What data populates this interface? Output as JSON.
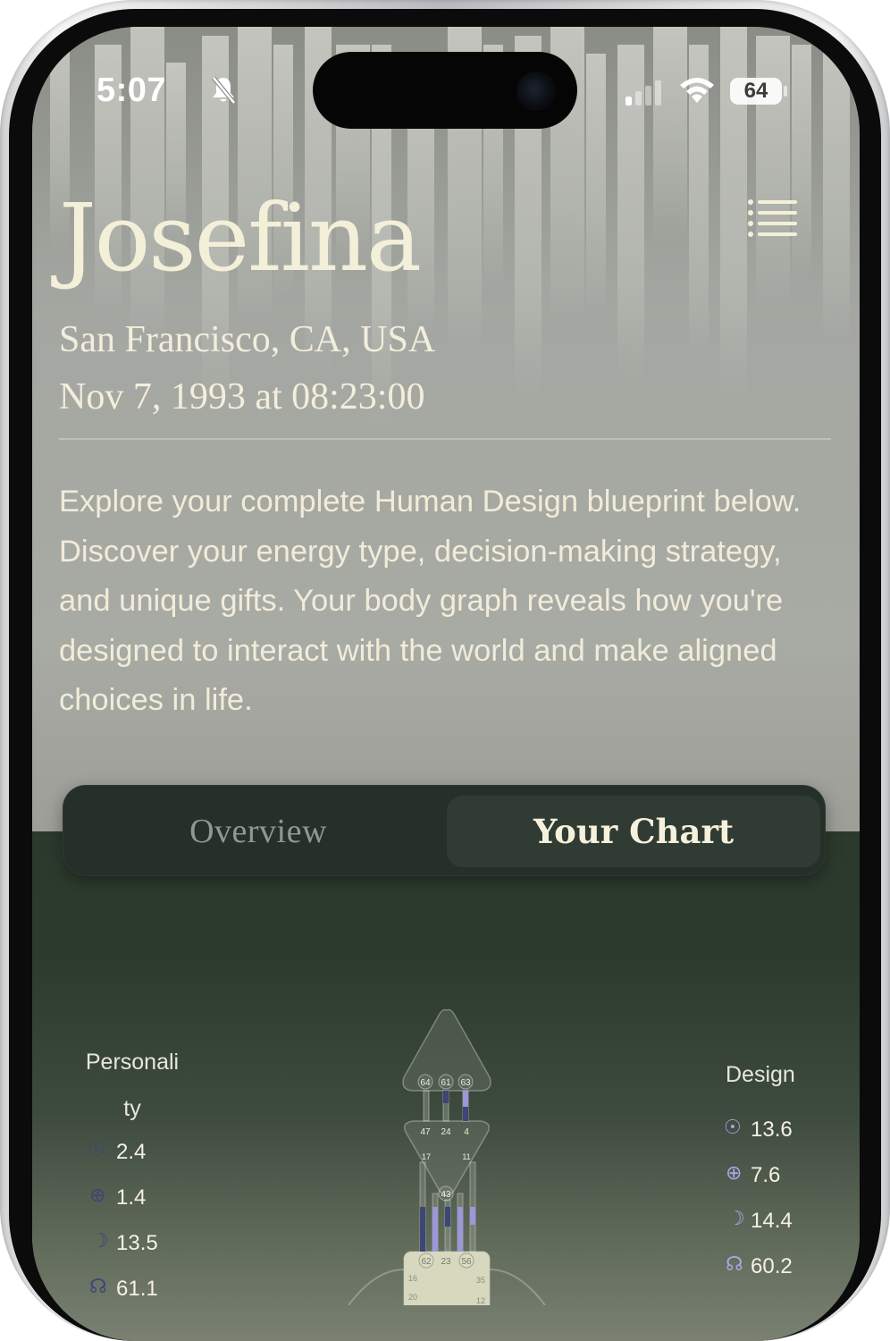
{
  "status_bar": {
    "time": "5:07",
    "battery": "64",
    "icons": [
      "bell-slash-icon",
      "signal-icon",
      "wifi-icon",
      "battery-icon"
    ]
  },
  "header": {
    "name": "Josefina",
    "location": "San Francisco, CA, USA",
    "birth": "Nov 7, 1993 at 08:23:00",
    "menu_icon": "hamburger-menu-icon"
  },
  "intro": "Explore your complete Human Design blueprint below. Discover your energy type, decision-making strategy, and unique gifts. Your body graph reveals how you're designed to interact with the world and make aligned choices in life.",
  "tabs": [
    {
      "label": "Overview",
      "active": false
    },
    {
      "label": "Your Chart",
      "active": true
    }
  ],
  "chart": {
    "personality": {
      "title_line1": "Personali",
      "title_line2": "ty",
      "rows": [
        {
          "icon": "sun-icon",
          "value": "2.4"
        },
        {
          "icon": "earth-icon",
          "value": "1.4"
        },
        {
          "icon": "moon-icon",
          "value": "13.5"
        },
        {
          "icon": "north-node-icon",
          "value": "61.1"
        }
      ]
    },
    "design": {
      "title": "Design",
      "rows": [
        {
          "icon": "sun-icon",
          "value": "13.6"
        },
        {
          "icon": "earth-icon",
          "value": "7.6"
        },
        {
          "icon": "moon-icon",
          "value": "14.4"
        },
        {
          "icon": "north-node-icon",
          "value": "60.2"
        }
      ]
    },
    "gates": {
      "head": [
        "64",
        "61",
        "63"
      ],
      "ajna_top": [
        "47",
        "24",
        "4"
      ],
      "ajna_side": [
        "17",
        "11"
      ],
      "ajna_bottom": "43",
      "throat_top": [
        "62",
        "23",
        "56"
      ],
      "throat_side": [
        "16",
        "35"
      ],
      "throat_bottom": [
        "20",
        "12"
      ]
    },
    "colors": {
      "personality": "#3d4676",
      "design": "#9c97d9",
      "center_fill": "#d8d8bf"
    }
  }
}
